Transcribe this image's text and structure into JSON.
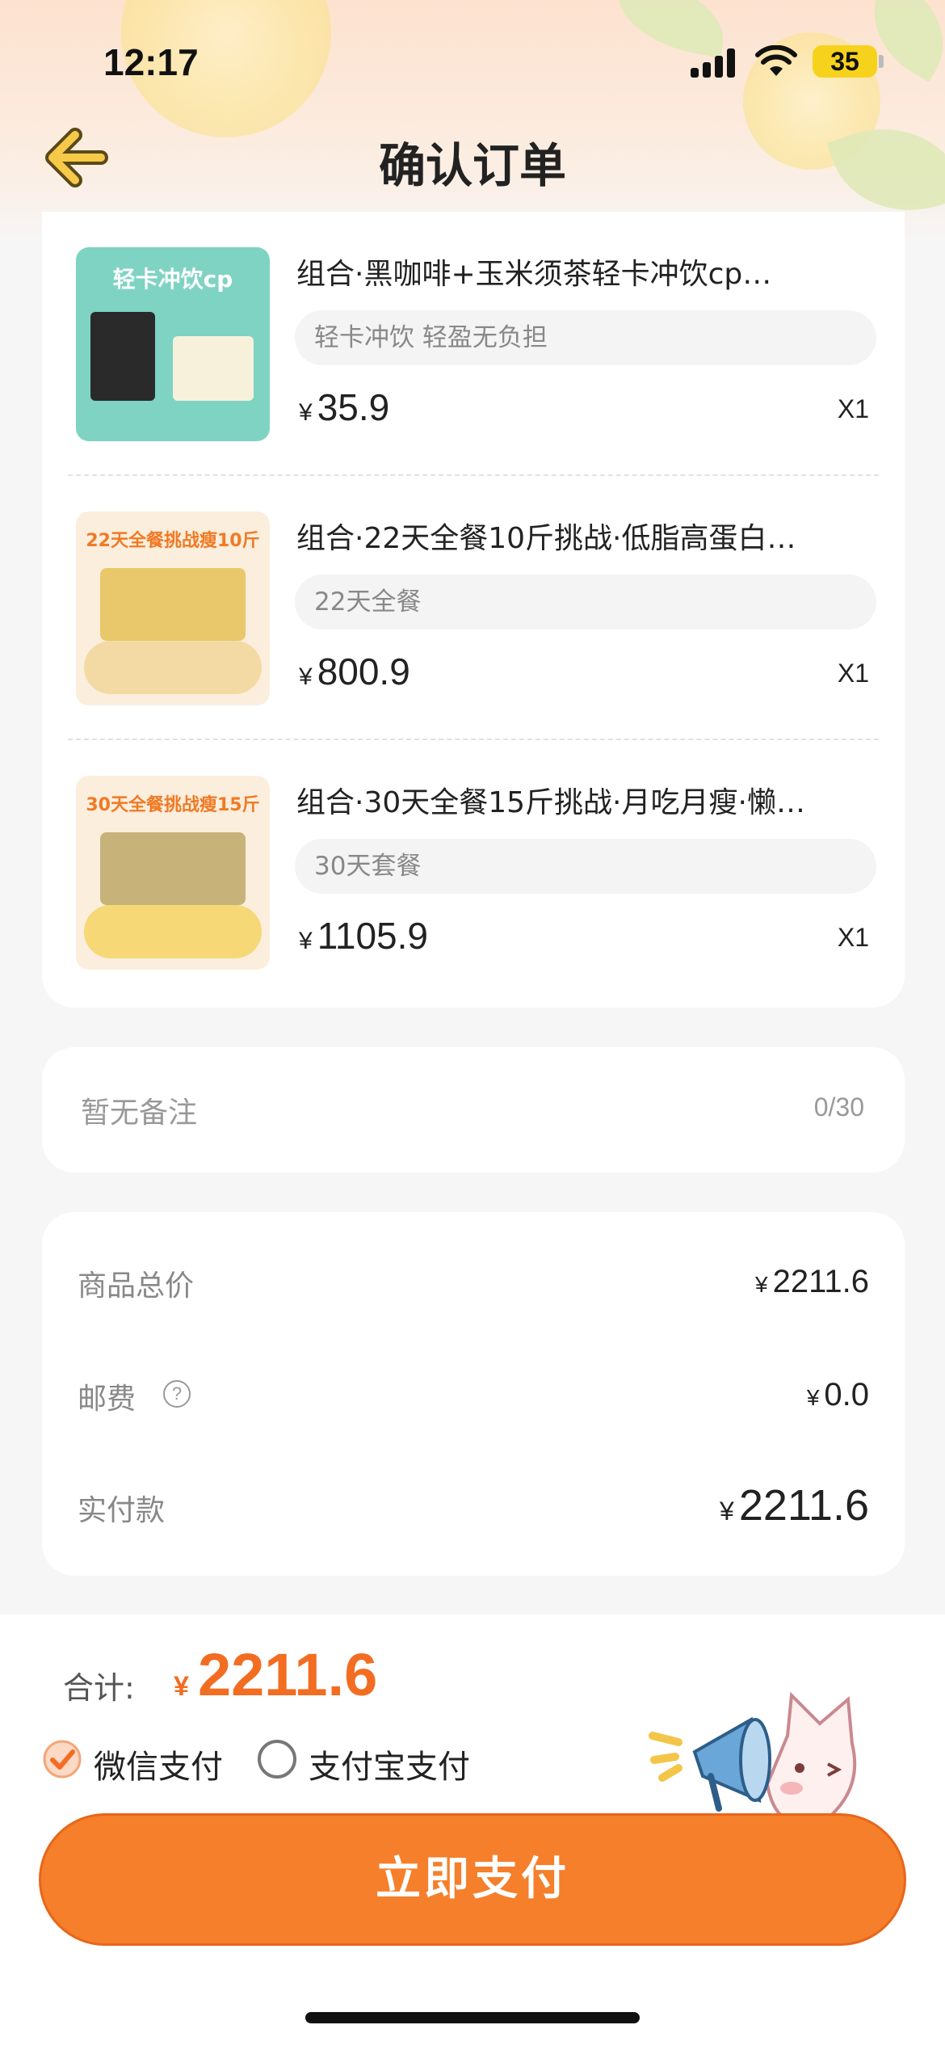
{
  "status_bar": {
    "time": "12:17",
    "battery": "35"
  },
  "header": {
    "title": "确认订单"
  },
  "items": [
    {
      "name": "组合·黑咖啡+玉米须茶轻卡冲饮cp…",
      "spec": "轻卡冲饮 轻盈无负担",
      "currency": "¥",
      "price": "35.9",
      "qty": "X1",
      "thumb_banner": "轻卡冲饮cp",
      "thumb_color": "#7fd3c3"
    },
    {
      "name": "组合·22天全餐10斤挑战·低脂高蛋白…",
      "spec": "22天全餐",
      "currency": "¥",
      "price": "800.9",
      "qty": "X1",
      "thumb_banner": "22天全餐挑战瘦10斤",
      "thumb_color": "#fbeedd"
    },
    {
      "name": "组合·30天全餐15斤挑战·月吃月瘦·懒…",
      "spec": "30天套餐",
      "currency": "¥",
      "price": "1105.9",
      "qty": "X1",
      "thumb_banner": "30天全餐挑战瘦15斤",
      "thumb_color": "#fbeedd"
    }
  ],
  "remark": {
    "placeholder": "暂无备注",
    "count": "0/30"
  },
  "summary": {
    "goods_total_label": "商品总价",
    "goods_total_value": "2211.6",
    "shipping_label": "邮费",
    "shipping_value": "0.0",
    "paid_label": "实付款",
    "paid_value": "2211.6",
    "currency": "¥",
    "help_icon": "?"
  },
  "bottom": {
    "total_label": "合计:",
    "currency": "¥",
    "total_amount": "2211.6",
    "pay_methods": [
      {
        "label": "微信支付",
        "selected": true
      },
      {
        "label": "支付宝支付",
        "selected": false
      }
    ],
    "pay_button": "立即支付"
  },
  "colors": {
    "accent": "#f57f2a",
    "price_accent": "#f26d22"
  }
}
